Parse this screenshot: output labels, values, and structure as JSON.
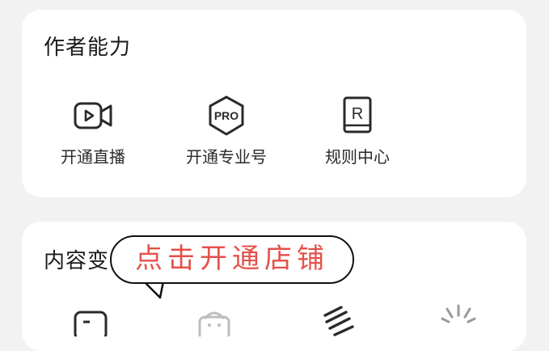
{
  "author_section": {
    "title": "作者能力",
    "features": [
      {
        "label": "开通直播",
        "icon": "live-video-icon"
      },
      {
        "label": "开通专业号",
        "icon": "pro-badge-icon"
      },
      {
        "label": "规则中心",
        "icon": "rules-book-icon"
      }
    ]
  },
  "content_section": {
    "title_visible": "内容变",
    "icons": [
      "wallet-icon",
      "shopping-bag-icon",
      "hand-icon",
      "sparkle-icon"
    ]
  },
  "annotation": {
    "bubble_text": "点击开通店铺"
  },
  "colors": {
    "background": "#f2f2f2",
    "card": "#ffffff",
    "annotation_text": "#e4504a"
  },
  "pro_icon_text": "PRO",
  "rules_icon_text": "R"
}
